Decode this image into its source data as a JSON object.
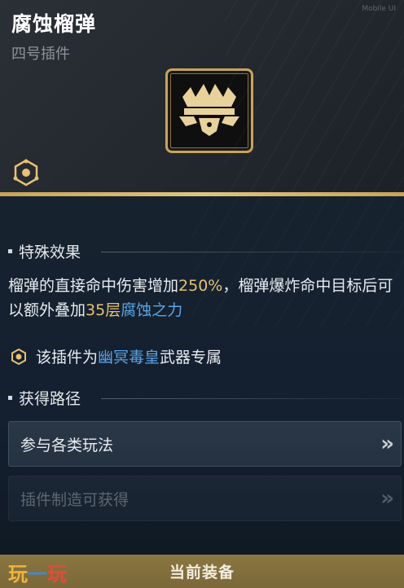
{
  "header": {
    "title": "腐蚀榴弹",
    "subtitle": "四号插件",
    "corner_mark": "Mobile UI"
  },
  "icons": {
    "plugin": "grenade-crown-icon",
    "weapon_badge": "weapon-hex-icon",
    "exclusive": "weapon-hex-small-icon",
    "chevron": "double-chevron-right-icon"
  },
  "colors": {
    "accent_gold": "#e6c173",
    "accent_blue": "#5ca3e6",
    "border_gold": "#c9a35a"
  },
  "special_effect": {
    "heading": "特殊效果",
    "text_1": "榴弹的直接命中伤害增加",
    "value_1": "250%",
    "text_2": "，榴弹爆炸命中目标后可以额外叠加",
    "value_2": "35层",
    "effect_name": "腐蚀之力"
  },
  "exclusive": {
    "prefix": "该插件为",
    "weapon": "幽冥毒皇",
    "suffix": "武器专属"
  },
  "acquire": {
    "heading": "获得路径",
    "routes": [
      {
        "label": "参与各类玩法"
      },
      {
        "label": "插件制造可获得"
      }
    ]
  },
  "footer": {
    "button_label": "当前装备",
    "watermark_1": "玩",
    "watermark_2": "一",
    "watermark_3": "玩"
  }
}
